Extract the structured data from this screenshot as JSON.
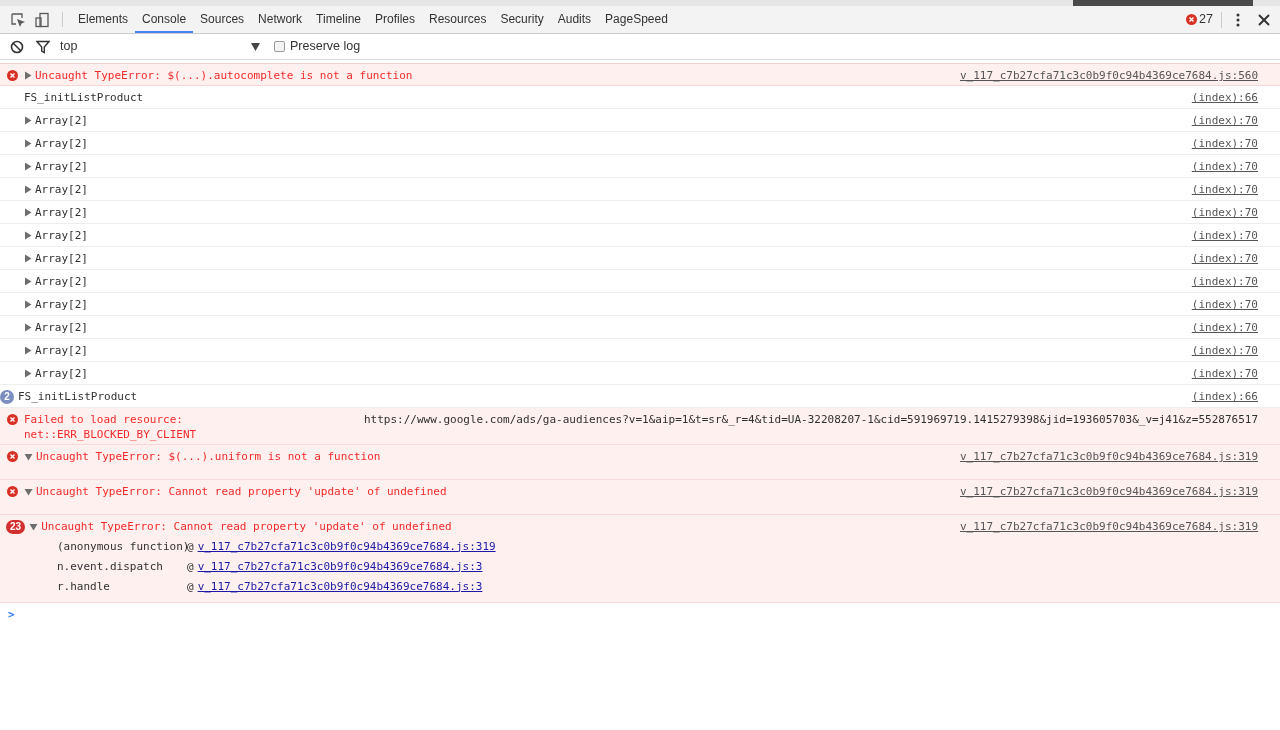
{
  "toolbar": {
    "tabs": [
      {
        "label": "Elements",
        "selected": false
      },
      {
        "label": "Console",
        "selected": true
      },
      {
        "label": "Sources",
        "selected": false
      },
      {
        "label": "Network",
        "selected": false
      },
      {
        "label": "Timeline",
        "selected": false
      },
      {
        "label": "Profiles",
        "selected": false
      },
      {
        "label": "Resources",
        "selected": false
      },
      {
        "label": "Security",
        "selected": false
      },
      {
        "label": "Audits",
        "selected": false
      },
      {
        "label": "PageSpeed",
        "selected": false
      }
    ],
    "error_count": "27"
  },
  "filter_bar": {
    "context": "top",
    "preserve_log": {
      "label": "Preserve log",
      "checked": false
    }
  },
  "messages": [
    {
      "kind": "error",
      "expanded": false,
      "text": "Uncaught TypeError: $(...).autocomplete is not a function",
      "source": "v_117_c7b27cfa71c3c0b9f0c94b4369ce7684.js:560"
    },
    {
      "kind": "log",
      "text": "FS_initListProduct",
      "source": "(index):66"
    },
    {
      "kind": "log",
      "expanded": false,
      "text": "Array[2]",
      "source": "(index):70"
    },
    {
      "kind": "log",
      "expanded": false,
      "text": "Array[2]",
      "source": "(index):70"
    },
    {
      "kind": "log",
      "expanded": false,
      "text": "Array[2]",
      "source": "(index):70"
    },
    {
      "kind": "log",
      "expanded": false,
      "text": "Array[2]",
      "source": "(index):70"
    },
    {
      "kind": "log",
      "expanded": false,
      "text": "Array[2]",
      "source": "(index):70"
    },
    {
      "kind": "log",
      "expanded": false,
      "text": "Array[2]",
      "source": "(index):70"
    },
    {
      "kind": "log",
      "expanded": false,
      "text": "Array[2]",
      "source": "(index):70"
    },
    {
      "kind": "log",
      "expanded": false,
      "text": "Array[2]",
      "source": "(index):70"
    },
    {
      "kind": "log",
      "expanded": false,
      "text": "Array[2]",
      "source": "(index):70"
    },
    {
      "kind": "log",
      "expanded": false,
      "text": "Array[2]",
      "source": "(index):70"
    },
    {
      "kind": "log",
      "expanded": false,
      "text": "Array[2]",
      "source": "(index):70"
    },
    {
      "kind": "log",
      "expanded": false,
      "text": "Array[2]",
      "source": "(index):70"
    },
    {
      "kind": "log",
      "count": "2",
      "text": "FS_initListProduct",
      "source": "(index):66"
    },
    {
      "kind": "error",
      "text": "Failed to load resource: net::ERR_BLOCKED_BY_CLIENT",
      "url": "https://www.google.com/ads/ga-audiences?v=1&aip=1&t=sr&_r=4&tid=UA-32208207-1&cid=591969719.1415279398&jid=193605703&_v=j41&z=552876517"
    },
    {
      "kind": "error",
      "expanded": true,
      "text": "Uncaught TypeError: $(...).uniform is not a function",
      "source": "v_117_c7b27cfa71c3c0b9f0c94b4369ce7684.js:319"
    },
    {
      "kind": "error",
      "expanded": true,
      "text": "Uncaught TypeError: Cannot read property 'update' of undefined",
      "source": "v_117_c7b27cfa71c3c0b9f0c94b4369ce7684.js:319"
    },
    {
      "kind": "error",
      "count": "23",
      "expanded": true,
      "text": "Uncaught TypeError: Cannot read property 'update' of undefined",
      "source": "v_117_c7b27cfa71c3c0b9f0c94b4369ce7684.js:319",
      "stack": [
        {
          "function": "(anonymous function)",
          "at": "@",
          "link": "v_117_c7b27cfa71c3c0b9f0c94b4369ce7684.js:319"
        },
        {
          "function": "n.event.dispatch",
          "at": "@",
          "link": "v_117_c7b27cfa71c3c0b9f0c94b4369ce7684.js:3"
        },
        {
          "function": "r.handle",
          "at": "@",
          "link": "v_117_c7b27cfa71c3c0b9f0c94b4369ce7684.js:3"
        }
      ]
    }
  ],
  "prompt": {
    "symbol": ">"
  }
}
